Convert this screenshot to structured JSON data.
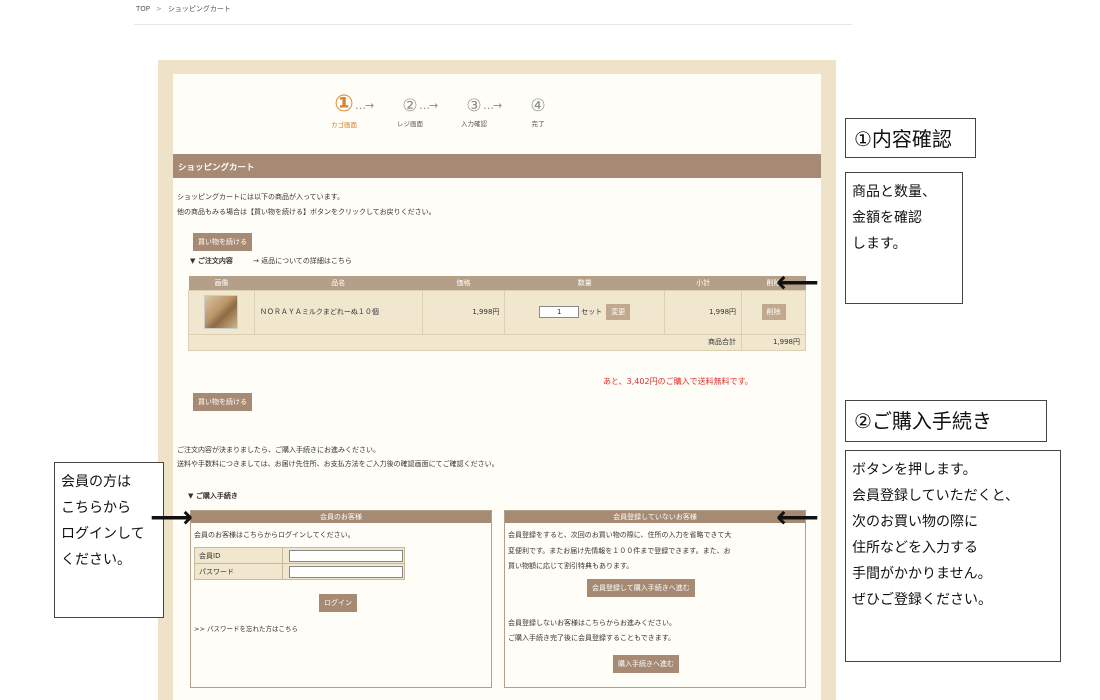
{
  "breadcrumb": {
    "home": "TOP",
    "sep": ">",
    "current": "ショッピングカート"
  },
  "steps": [
    {
      "num": "①",
      "label": "カゴ画面"
    },
    {
      "num": "②",
      "label": "レジ画面"
    },
    {
      "num": "③",
      "label": "入力確認"
    },
    {
      "num": "④",
      "label": "完了"
    }
  ],
  "step_arrow": "…→",
  "section_title": "ショッピングカート",
  "intro": {
    "line1": "ショッピングカートには以下の商品が入っています。",
    "line2": "他の商品もみる場合は【買い物を続ける】ボタンをクリックしてお戻りください。"
  },
  "continue_button": "買い物を続ける",
  "order": {
    "heading": "▼ ご注文内容",
    "returns_link": "→ 返品についての詳細はこちら",
    "columns": [
      "画像",
      "品名",
      "価格",
      "数量",
      "小計",
      "削除"
    ],
    "item": {
      "name": "ＮＯＲＡＹＡミルクまどれーぬ１０個",
      "price": "1,998円",
      "qty": "1",
      "unit": "セット",
      "change_button": "変更",
      "subtotal": "1,998円",
      "delete_button": "削除"
    },
    "total_label": "商品合計",
    "total": "1,998円"
  },
  "free_shipping_notice": "あと、3,402円のご購入で送料無料です。",
  "proceed": {
    "line1": "ご注文内容が決まりましたら、ご購入手続きにお進みください。",
    "line2": "送料や手数料につきましては、お届け先住所、お支払方法をご入力後の確認画面にてご確認ください。",
    "heading": "▼ ご購入手続き"
  },
  "member_panel": {
    "title": "会員のお客様",
    "desc": "会員のお客様はこちらからログインしてください。",
    "id_label": "会員ID",
    "password_label": "パスワード",
    "login_button": "ログイン",
    "forgot_link": ">> パスワードを忘れた方はこちら"
  },
  "guest_panel": {
    "title": "会員登録していないお客様",
    "desc1": "会員登録をすると、次回のお買い物の際に、住所の入力を省略できて大",
    "desc2": "変便利です。またお届け先情報を１００件まで登録できます。また、お",
    "desc3": "買い物額に応じて割引特典もあります。",
    "register_button": "会員登録して購入手続きへ進む",
    "desc4": "会員登録しないお客様はこちらからお進みください。",
    "desc5": "ご購入手続き完了後に会員登録することもできます。",
    "guest_button": "購入手続きへ進む"
  },
  "callouts": {
    "c1_title": "①内容確認",
    "c1_lines": [
      "商品と数量、",
      "金額を確認",
      "します。"
    ],
    "c2_title": "②ご購入手続き",
    "c2_lines": [
      "ボタンを押します。",
      "会員登録していただくと、",
      "次のお買い物の際に",
      "住所などを入力する",
      "手間がかかりません。",
      "ぜひご登録ください。"
    ],
    "c3_lines": [
      "会員の方は",
      "こちらから",
      "ログインして",
      "ください。"
    ]
  },
  "colors": {
    "accent_brown": "#a78a73",
    "step_active": "#d9822b",
    "notice_red": "#e03030",
    "frame_beige": "#eee3c8"
  }
}
